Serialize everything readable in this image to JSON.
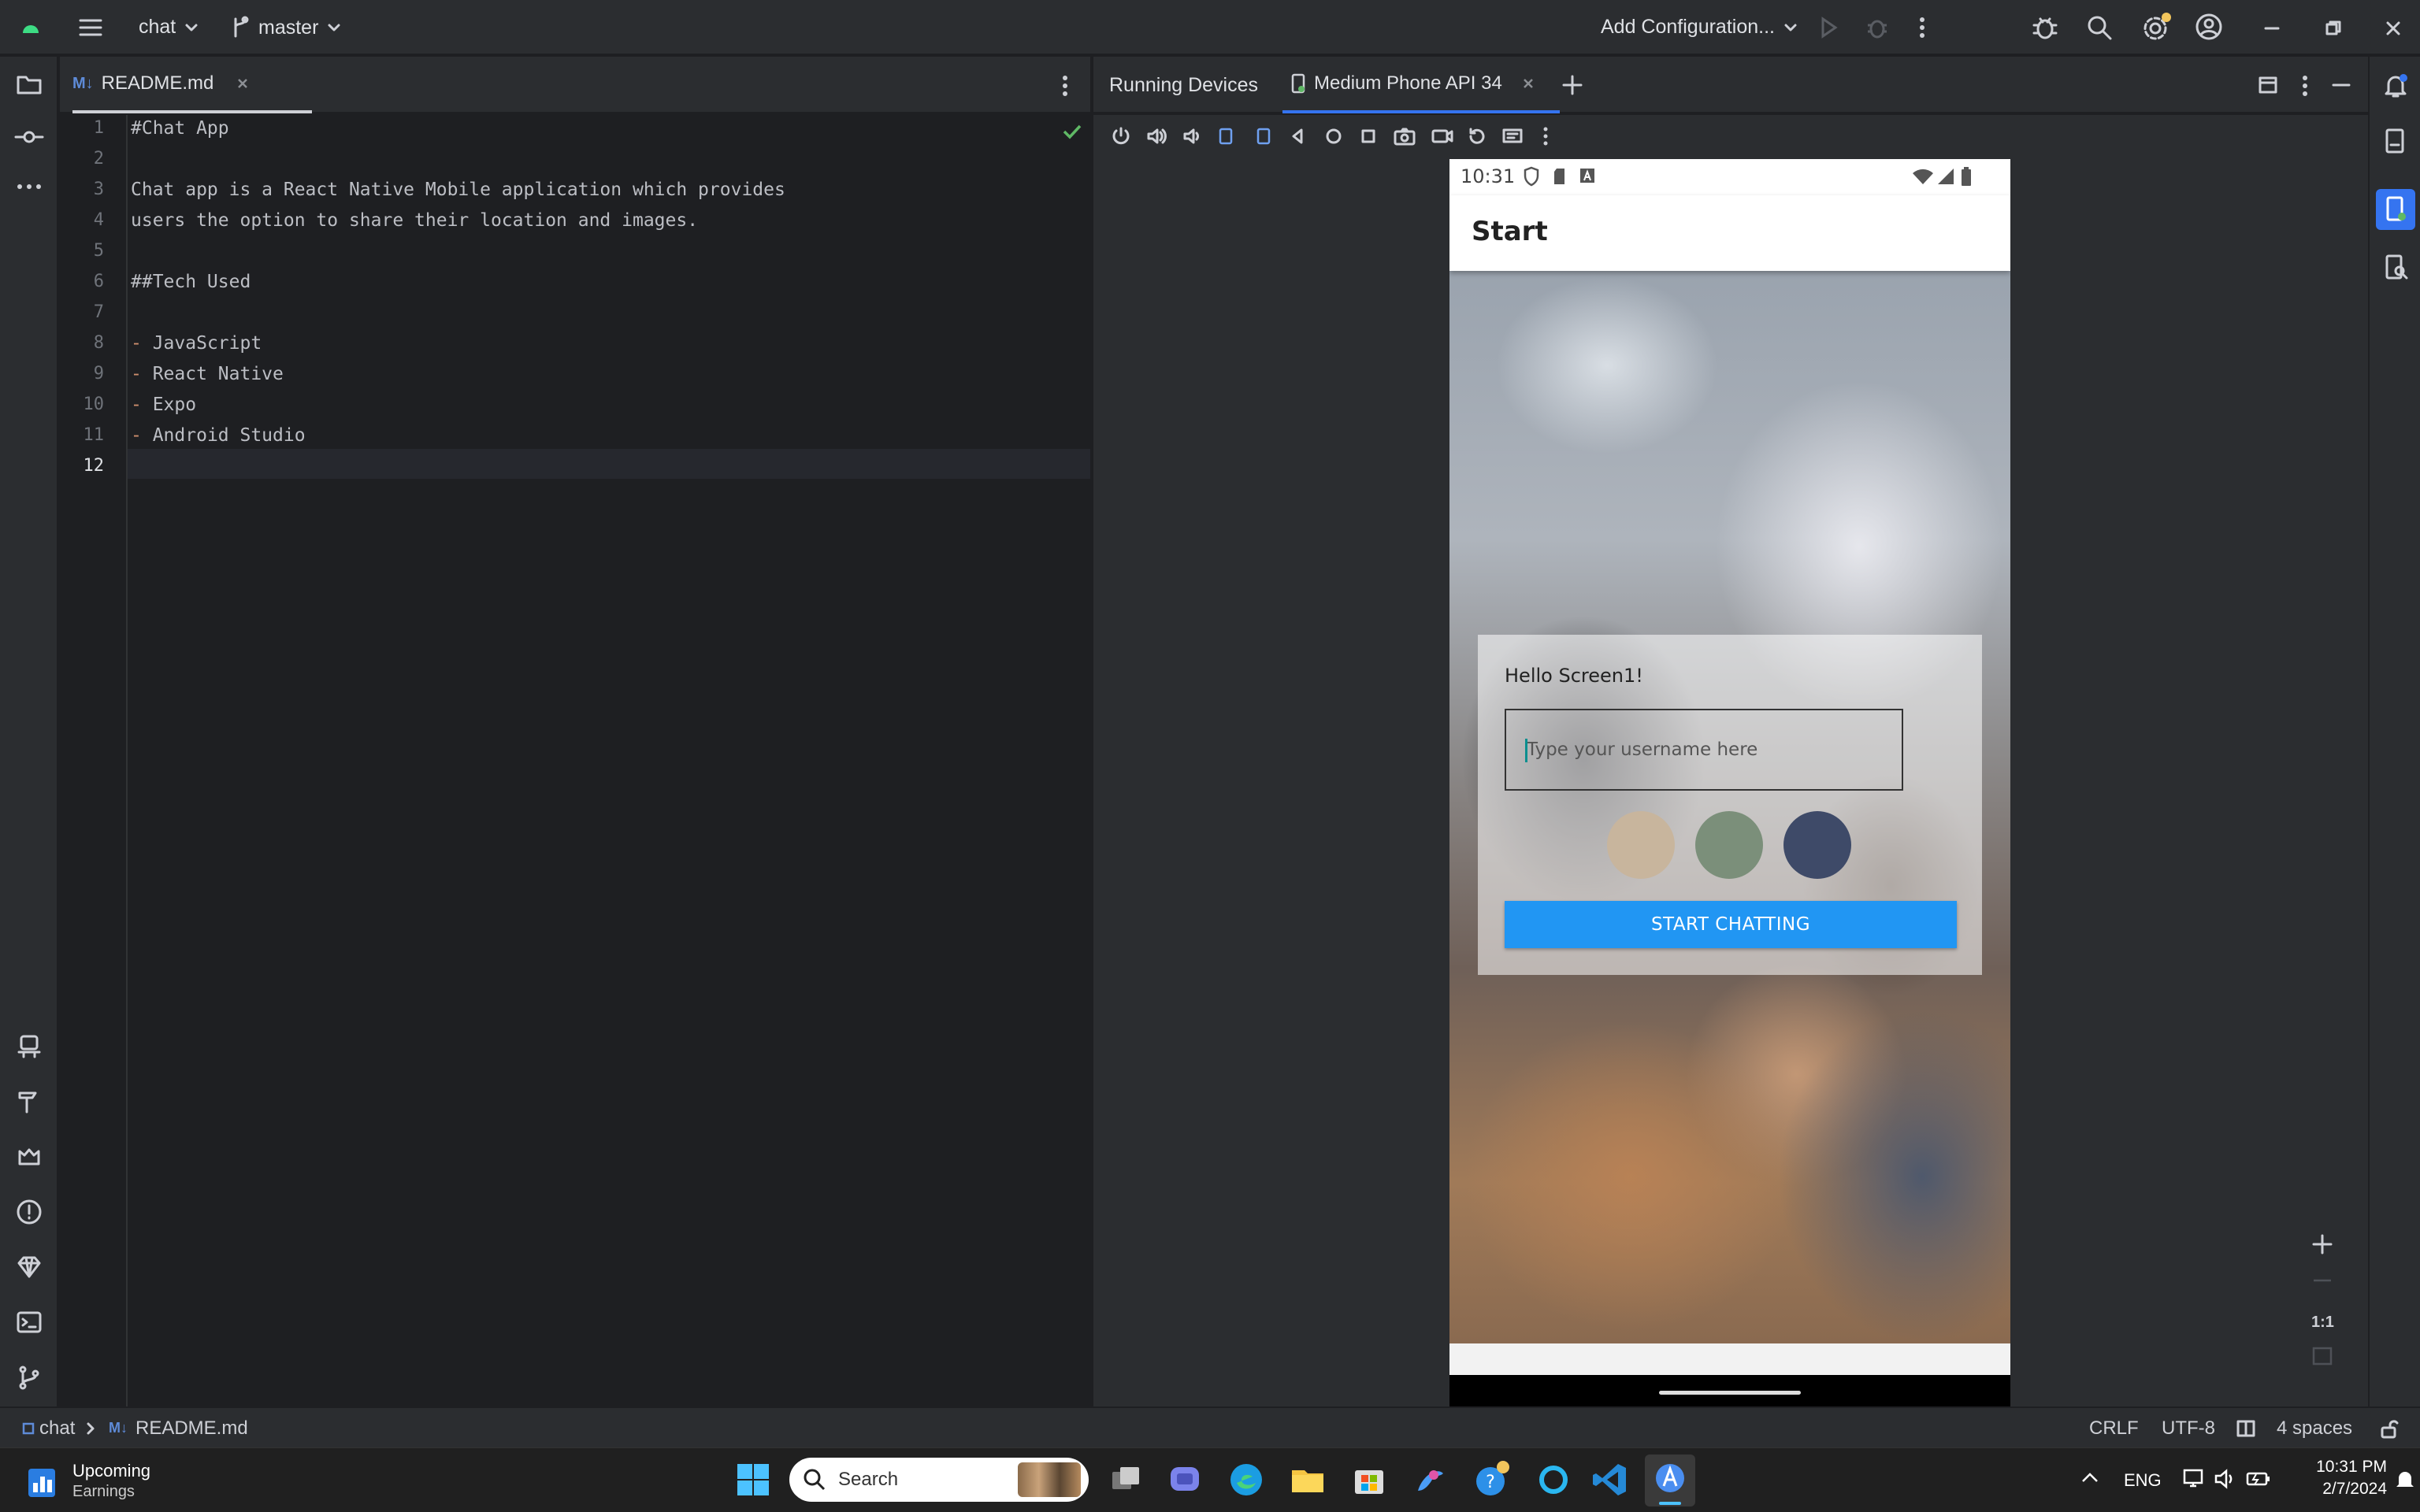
{
  "titlebar": {
    "project": "chat",
    "branch": "master",
    "run_config": "Add Configuration..."
  },
  "editor": {
    "tab_label": "README.md",
    "tab_prefix": "M↓",
    "lines": [
      {
        "n": "1",
        "text": "#Chat App"
      },
      {
        "n": "2",
        "text": ""
      },
      {
        "n": "3",
        "text": "Chat app is a React Native Mobile application which provides"
      },
      {
        "n": "4",
        "text": "users the option to share their location and images."
      },
      {
        "n": "5",
        "text": ""
      },
      {
        "n": "6",
        "text": "##Tech Used"
      },
      {
        "n": "7",
        "text": ""
      },
      {
        "n": "8",
        "text": " JavaScript"
      },
      {
        "n": "9",
        "text": " React Native"
      },
      {
        "n": "10",
        "text": " Expo"
      },
      {
        "n": "11",
        "text": " Android Studio"
      },
      {
        "n": "12",
        "text": ""
      }
    ],
    "dash": "-"
  },
  "running_devices": {
    "title": "Running Devices",
    "device_tab": "Medium Phone API 34"
  },
  "phone": {
    "time": "10:31",
    "app_title": "Start",
    "hello": "Hello Screen1!",
    "username_placeholder": "Type your username here",
    "swatch_colors": [
      "#c8b59d",
      "#7b8f7a",
      "#3e4a68"
    ],
    "button_label": "START CHATTING",
    "button_color": "#2196f3"
  },
  "zoom": {
    "ratio": "1:1"
  },
  "status": {
    "crumb_project": "chat",
    "crumb_file": "README.md",
    "crumb_file_prefix": "M↓",
    "line_sep": "CRLF",
    "encoding": "UTF-8",
    "indent": "4 spaces"
  },
  "taskbar": {
    "widget_title": "Upcoming",
    "widget_sub": "Earnings",
    "search": "Search",
    "lang": "ENG",
    "time": "10:31 PM",
    "date": "2/7/2024"
  }
}
